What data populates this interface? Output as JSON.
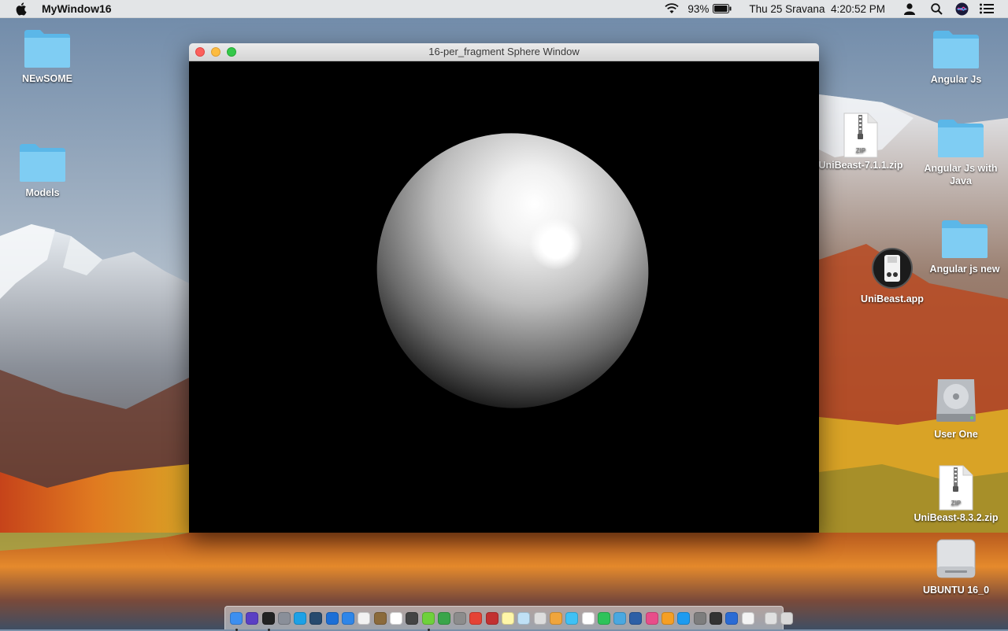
{
  "menubar": {
    "app_name": "MyWindow16",
    "battery_percent": "93%",
    "datetime": "Thu 25 Sravana  4:20:52 PM"
  },
  "window": {
    "title": "16-per_fragment Sphere Window"
  },
  "desktop_icons": {
    "newsome": "NEwSOME",
    "models": "Models",
    "angular_js": "Angular Js",
    "unibeast_711": "UniBeast-7.1.1.zip",
    "angular_js_java": "Angular Js with Java",
    "angular_js_new": "Angular js new",
    "unibeast_app": "UniBeast.app",
    "user_one": "User One",
    "unibeast_832": "UniBeast-8.3.2.zip",
    "ubuntu": "UBUNTU 16_0",
    "zip_badge": "ZIP"
  },
  "dock_items": [
    {
      "name": "finder",
      "color": "#3d8ff0",
      "running": true
    },
    {
      "name": "siri",
      "color": "#5a3fc4",
      "running": false
    },
    {
      "name": "terminal",
      "color": "#222222",
      "running": true
    },
    {
      "name": "launchpad",
      "color": "#8a8f99",
      "running": false
    },
    {
      "name": "skype",
      "color": "#1da1e6",
      "running": false
    },
    {
      "name": "quicktime",
      "color": "#274a6e",
      "running": false
    },
    {
      "name": "xcode",
      "color": "#1d6fd6",
      "running": false
    },
    {
      "name": "safari",
      "color": "#2f86e8",
      "running": false
    },
    {
      "name": "textedit",
      "color": "#f2f2f2",
      "running": false
    },
    {
      "name": "notes-brown",
      "color": "#8b6a3b",
      "running": false
    },
    {
      "name": "calendar",
      "color": "#ffffff",
      "running": false
    },
    {
      "name": "ibooks",
      "color": "#444444",
      "running": false
    },
    {
      "name": "upwork",
      "color": "#6fd13b",
      "running": true
    },
    {
      "name": "utorrent",
      "color": "#3aa54a",
      "running": false
    },
    {
      "name": "automator",
      "color": "#8c8c8c",
      "running": false
    },
    {
      "name": "chrome",
      "color": "#e54335",
      "running": false
    },
    {
      "name": "photo-booth",
      "color": "#c23131",
      "running": false
    },
    {
      "name": "notes",
      "color": "#fff6a8",
      "running": false
    },
    {
      "name": "preview",
      "color": "#bfe0f5",
      "running": false
    },
    {
      "name": "script",
      "color": "#dddddd",
      "running": false
    },
    {
      "name": "photos",
      "color": "#f0a53c",
      "running": false
    },
    {
      "name": "messages",
      "color": "#3fc1f5",
      "running": false
    },
    {
      "name": "document",
      "color": "#ffffff",
      "running": false
    },
    {
      "name": "wechat",
      "color": "#2ec35a",
      "running": false
    },
    {
      "name": "maps",
      "color": "#4aa8e0",
      "running": false
    },
    {
      "name": "xquartz",
      "color": "#2d5fa6",
      "running": false
    },
    {
      "name": "itunes",
      "color": "#e84d8a",
      "running": false
    },
    {
      "name": "ibooks-orange",
      "color": "#f59f24",
      "running": false
    },
    {
      "name": "app-store",
      "color": "#1d9bf0",
      "running": false
    },
    {
      "name": "system-preferences",
      "color": "#7d7d7d",
      "running": false
    },
    {
      "name": "dvd-player",
      "color": "#333333",
      "running": false
    },
    {
      "name": "mission-control",
      "color": "#2a6bd4",
      "running": false
    },
    {
      "name": "zip-archive",
      "color": "#f4f4f4",
      "running": false
    },
    {
      "name": "downloads-stack",
      "color": "#e0e0e0",
      "running": false
    },
    {
      "name": "trash",
      "color": "#d9d9d9",
      "running": false
    }
  ]
}
